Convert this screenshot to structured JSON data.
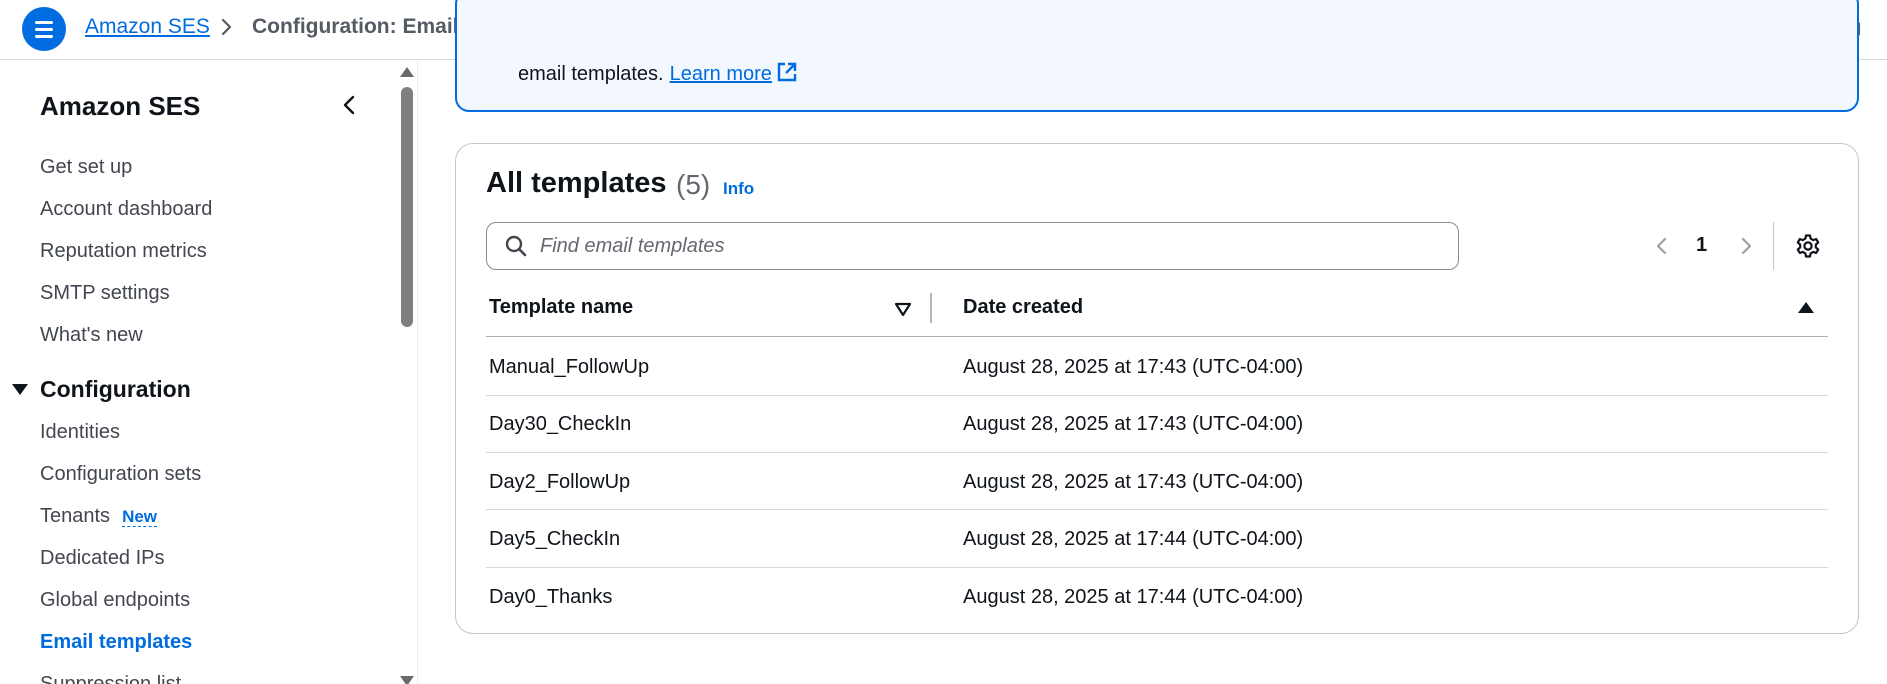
{
  "topbar": {
    "service_link": "Amazon SES",
    "current_page": "Configuration: Email templates"
  },
  "sidebar": {
    "title": "Amazon SES",
    "top_items": [
      "Get set up",
      "Account dashboard",
      "Reputation metrics",
      "SMTP settings",
      "What's new"
    ],
    "section_title": "Configuration",
    "config_items": [
      "Identities",
      "Configuration sets",
      "Tenants",
      "Dedicated IPs",
      "Global endpoints",
      "Email templates",
      "Suppression list"
    ],
    "tenants_badge": "New",
    "active_item": "Email templates"
  },
  "banner": {
    "text": "email templates.",
    "link": "Learn more"
  },
  "templates": {
    "title": "All templates",
    "count": "(5)",
    "info": "Info",
    "search_placeholder": "Find email templates",
    "search_value": "",
    "page": "1",
    "columns": [
      "Template name",
      "Date created"
    ],
    "rows": [
      {
        "name": "Manual_FollowUp",
        "date": "August 28, 2025 at 17:43 (UTC-04:00)"
      },
      {
        "name": "Day30_CheckIn",
        "date": "August 28, 2025 at 17:43 (UTC-04:00)"
      },
      {
        "name": "Day2_FollowUp",
        "date": "August 28, 2025 at 17:43 (UTC-04:00)"
      },
      {
        "name": "Day5_CheckIn",
        "date": "August 28, 2025 at 17:44 (UTC-04:00)"
      },
      {
        "name": "Day0_Thanks",
        "date": "August 28, 2025 at 17:44 (UTC-04:00)"
      }
    ]
  },
  "icons": [
    "menu-icon",
    "chevron-right-icon",
    "info-icon",
    "settings-icon",
    "chevron-left-icon",
    "external-link-icon",
    "search-icon",
    "sort-down-icon",
    "sort-up-icon"
  ],
  "colors": {
    "accent": "#006ce0",
    "text": "#0f141a",
    "muted": "#656871"
  }
}
